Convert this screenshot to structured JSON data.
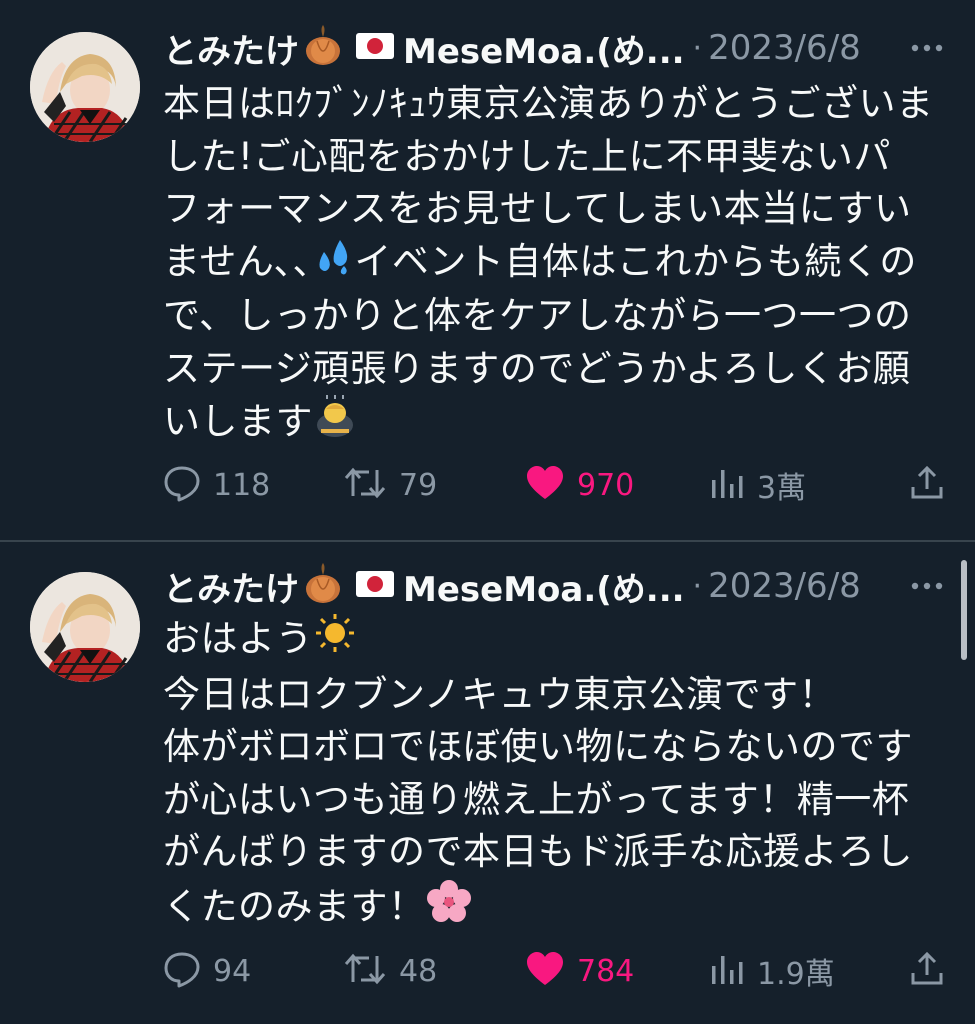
{
  "tweets": [
    {
      "display_name": "とみたけ",
      "name_emoji_1": "onion-emoji",
      "name_emoji_2": "japan-flag-emoji",
      "handle": "MeseMoa.(め...",
      "separator": "·",
      "date": "2023/6/8",
      "text": "本日はﾛｸﾌﾞﾝﾉｷｭｳ東京公演ありがとうございま\nした!ご心配をおかけした上に不甲斐ないパ\nフォーマンスをお見せしてしまい本当にすい\nません､､",
      "text_mid": "イベント自体はこれからも続くの\nで、しっかりと体をケアしながら一つ一つの\nステージ頑張りますのでどうかよろしくお願\nいします",
      "reply_count": "118",
      "retweet_count": "79",
      "like_count": "970",
      "view_count": "3萬",
      "liked": true
    },
    {
      "display_name": "とみたけ",
      "name_emoji_1": "onion-emoji",
      "name_emoji_2": "japan-flag-emoji",
      "handle": "MeseMoa.(め...",
      "separator": "·",
      "date": "2023/6/8",
      "text": "おはよう",
      "text_mid": "\n今日はロクブンノキュウ東京公演です！\n体がボロボロでほぼ使い物にならないのです\nが心はいつも通り燃え上がってます！精一杯\nがんばりますので本日もド派手な応援よろし\nくたのみます！",
      "reply_count": "94",
      "retweet_count": "48",
      "like_count": "784",
      "view_count": "1.9萬",
      "liked": true
    }
  ],
  "colors": {
    "background": "#15202b",
    "text_primary": "#f7f9f9",
    "text_secondary": "#8b98a5",
    "like_pink": "#f91880",
    "divider": "#38444d"
  },
  "icons": {
    "reply": "reply-bubble-icon",
    "retweet": "retweet-icon",
    "like": "heart-filled-icon",
    "views": "views-bar-chart-icon",
    "share": "share-upload-icon",
    "more": "more-dots-icon",
    "emoji_sweat": "sweat-droplets-emoji",
    "emoji_bow": "bowing-person-emoji",
    "emoji_sun": "sun-emoji",
    "emoji_blossom": "cherry-blossom-emoji"
  }
}
